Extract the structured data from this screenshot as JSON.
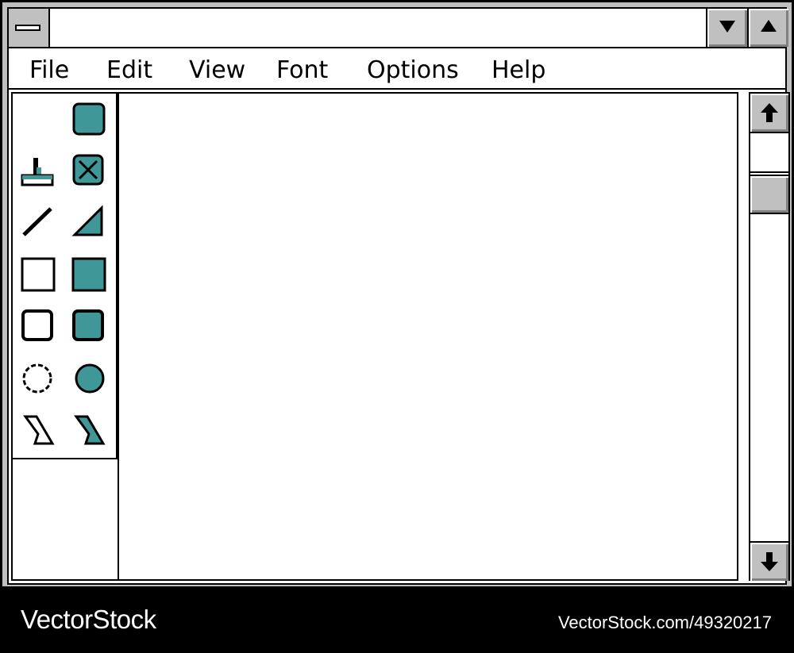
{
  "titlebar": {
    "title": "",
    "system_menu_icon": "system-menu-icon",
    "minimize_icon": "triangle-down-icon",
    "maximize_icon": "triangle-up-icon"
  },
  "menubar": {
    "items": [
      "File",
      "Edit",
      "View",
      "Font",
      "Options",
      "Help"
    ]
  },
  "toolbox": {
    "tools": [
      {
        "name": "selection-empty",
        "icon": "empty"
      },
      {
        "name": "pick-rounded-filled",
        "icon": "rounded-square-filled-icon"
      },
      {
        "name": "paint-roller",
        "icon": "roller-icon"
      },
      {
        "name": "eraser-x",
        "icon": "x-box-icon"
      },
      {
        "name": "line",
        "icon": "line-icon"
      },
      {
        "name": "filled-triangle",
        "icon": "triangle-filled-icon"
      },
      {
        "name": "rectangle-outline",
        "icon": "rectangle-outline-icon"
      },
      {
        "name": "rectangle-filled",
        "icon": "rectangle-filled-icon"
      },
      {
        "name": "rounded-rectangle-outline",
        "icon": "rounded-rectangle-outline-icon"
      },
      {
        "name": "rounded-rectangle-filled",
        "icon": "rounded-rectangle-filled-icon"
      },
      {
        "name": "ellipse-outline",
        "icon": "ellipse-outline-icon"
      },
      {
        "name": "ellipse-filled",
        "icon": "ellipse-filled-icon"
      },
      {
        "name": "polygon-outline",
        "icon": "polygon-outline-icon"
      },
      {
        "name": "polygon-filled",
        "icon": "polygon-filled-icon"
      }
    ]
  },
  "scrollbar": {
    "up_icon": "arrow-up-icon",
    "down_icon": "arrow-down-icon"
  },
  "colors": {
    "accent": "#3f9797",
    "chrome": "#c0c0c0",
    "border": "#000000"
  },
  "watermark": {
    "logo": "VectorStock",
    "url": "VectorStock.com/49320217"
  }
}
